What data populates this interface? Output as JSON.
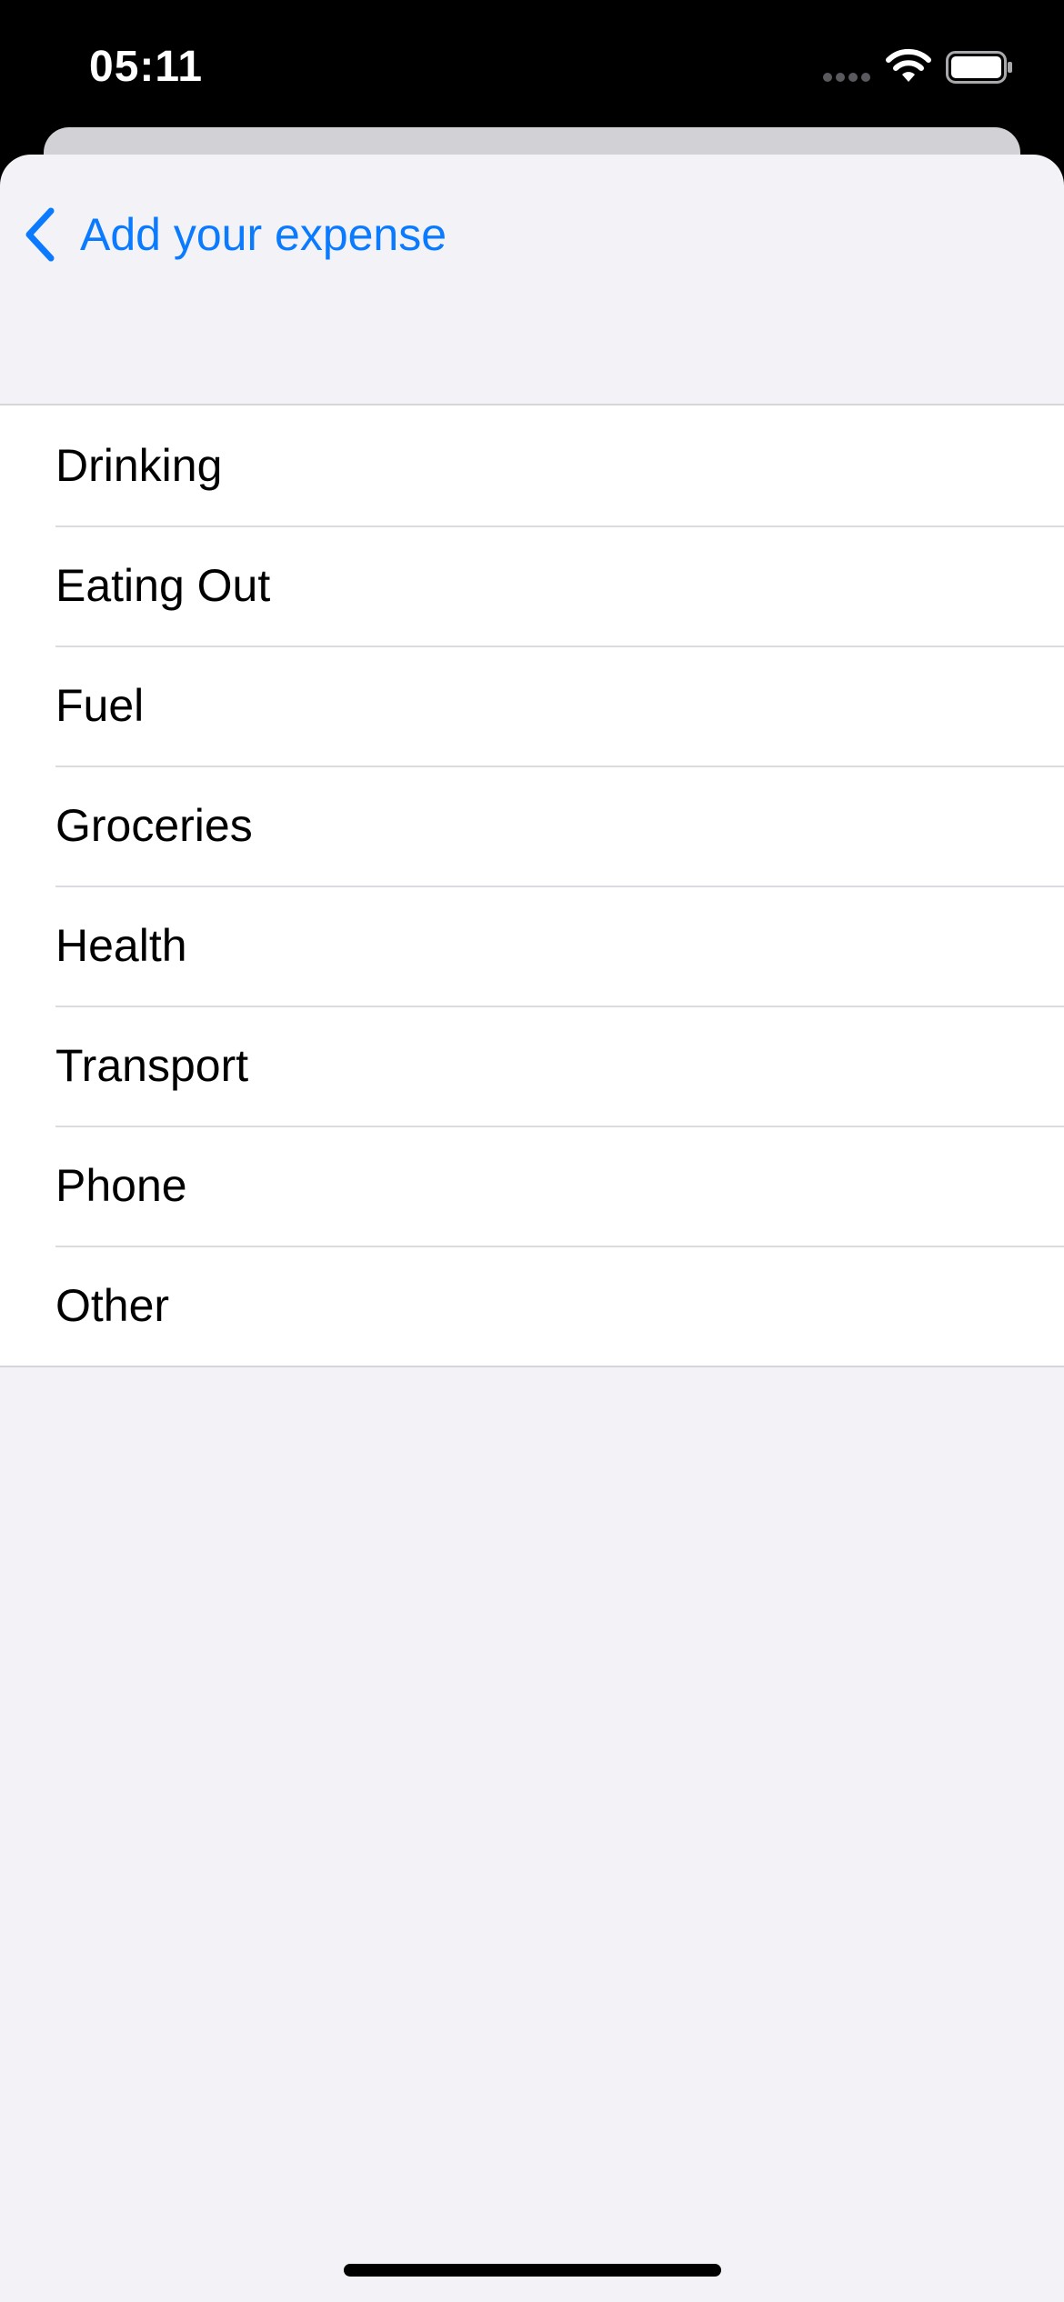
{
  "status_bar": {
    "time": "05:11",
    "icons": [
      "cellular-signal-icon",
      "wifi-icon",
      "battery-icon"
    ]
  },
  "nav": {
    "back_icon": "chevron-left-icon",
    "back_label": "Add your expense"
  },
  "categories": [
    {
      "label": "Drinking"
    },
    {
      "label": "Eating Out"
    },
    {
      "label": "Fuel"
    },
    {
      "label": "Groceries"
    },
    {
      "label": "Health"
    },
    {
      "label": "Transport"
    },
    {
      "label": "Phone"
    },
    {
      "label": "Other"
    }
  ],
  "colors": {
    "accent": "#0a7aff",
    "background": "#f2f2f7",
    "cell": "#ffffff",
    "status_bar": "#000000"
  }
}
